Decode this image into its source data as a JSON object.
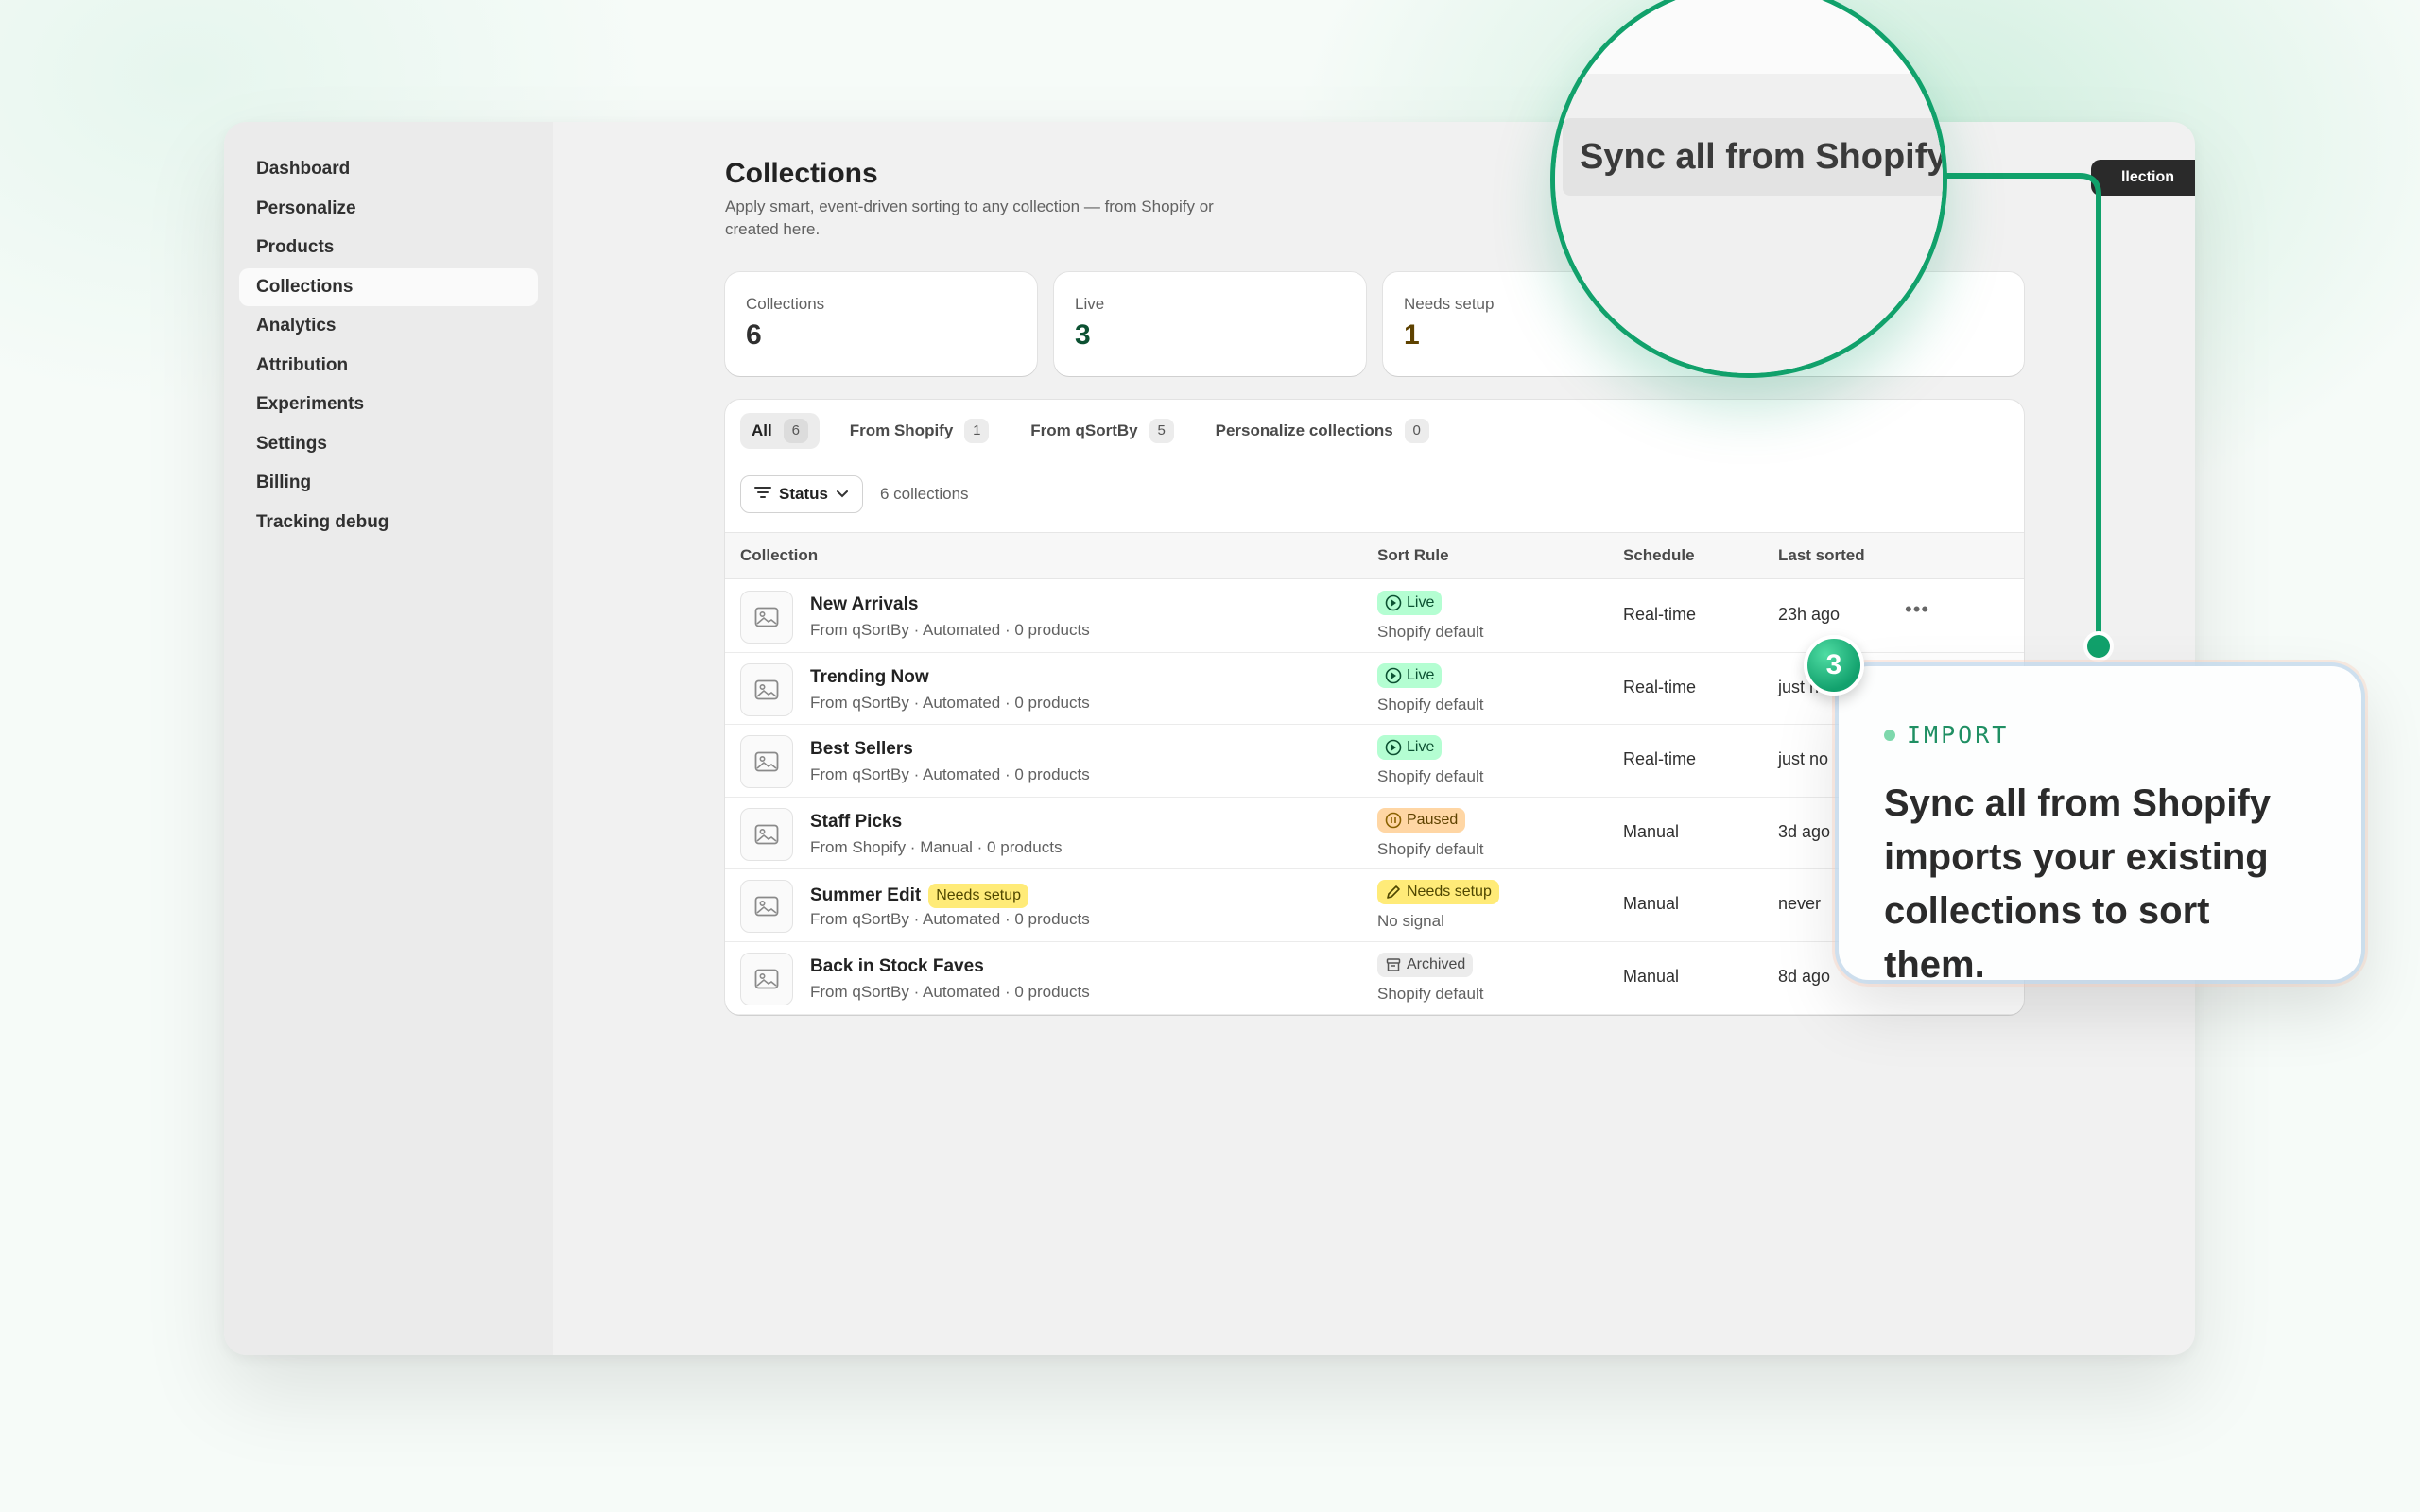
{
  "sidebar": {
    "items": [
      {
        "label": "Dashboard"
      },
      {
        "label": "Personalize"
      },
      {
        "label": "Products"
      },
      {
        "label": "Collections",
        "active": true
      },
      {
        "label": "Analytics"
      },
      {
        "label": "Attribution"
      },
      {
        "label": "Experiments"
      },
      {
        "label": "Settings"
      },
      {
        "label": "Billing"
      },
      {
        "label": "Tracking debug"
      }
    ]
  },
  "header": {
    "title": "Collections",
    "subtitle": "Apply smart, event-driven sorting to any collection — from Shopify or created here.",
    "new_button_label": "llection"
  },
  "stats": [
    {
      "label": "Collections",
      "value": "6",
      "color": "#303030"
    },
    {
      "label": "Live",
      "value": "3",
      "color": "#0c5132"
    },
    {
      "label": "Needs setup",
      "value": "1",
      "color": "#5e4200"
    }
  ],
  "tabs": [
    {
      "label": "All",
      "count": "6"
    },
    {
      "label": "From Shopify",
      "count": "1"
    },
    {
      "label": "From qSortBy",
      "count": "5"
    },
    {
      "label": "Personalize collections",
      "count": "0"
    }
  ],
  "filter": {
    "status_label": "Status",
    "count_text": "6 collections"
  },
  "table": {
    "columns": [
      "Collection",
      "Sort Rule",
      "Schedule",
      "Last sorted"
    ],
    "rows": [
      {
        "name": "New Arrivals",
        "meta": "From qSortBy · Automated · 0 products",
        "status": "Live",
        "status_type": "live",
        "rule": "Shopify default",
        "schedule": "Real-time",
        "last": "23h ago"
      },
      {
        "name": "Trending Now",
        "meta": "From qSortBy · Automated · 0 products",
        "status": "Live",
        "status_type": "live",
        "rule": "Shopify default",
        "schedule": "Real-time",
        "last": "just n"
      },
      {
        "name": "Best Sellers",
        "meta": "From qSortBy · Automated · 0 products",
        "status": "Live",
        "status_type": "live",
        "rule": "Shopify default",
        "schedule": "Real-time",
        "last": "just no"
      },
      {
        "name": "Staff Picks",
        "meta": "From Shopify · Manual · 0 products",
        "status": "Paused",
        "status_type": "paused",
        "rule": "Shopify default",
        "schedule": "Manual",
        "last": "3d ago"
      },
      {
        "name": "Summer Edit",
        "name_badge": "Needs setup",
        "meta": "From qSortBy · Automated · 0 products",
        "status": "Needs setup",
        "status_type": "setup",
        "rule": "No signal",
        "schedule": "Manual",
        "last": "never"
      },
      {
        "name": "Back in Stock Faves",
        "meta": "From qSortBy · Automated · 0 products",
        "status": "Archived",
        "status_type": "archived",
        "rule": "Shopify default",
        "schedule": "Manual",
        "last": "8d ago"
      }
    ],
    "row_menu": "•••"
  },
  "magnifier": {
    "button_label": "Sync all from Shopify"
  },
  "callout": {
    "step": "3",
    "tag": "IMPORT",
    "body": "Sync all from Shopify imports your existing collections to sort them."
  },
  "colors": {
    "accent": "#11a16b",
    "live_bg": "#b4fed2",
    "paused_bg": "#ffd6a4",
    "setup_bg": "#ffeb78"
  }
}
